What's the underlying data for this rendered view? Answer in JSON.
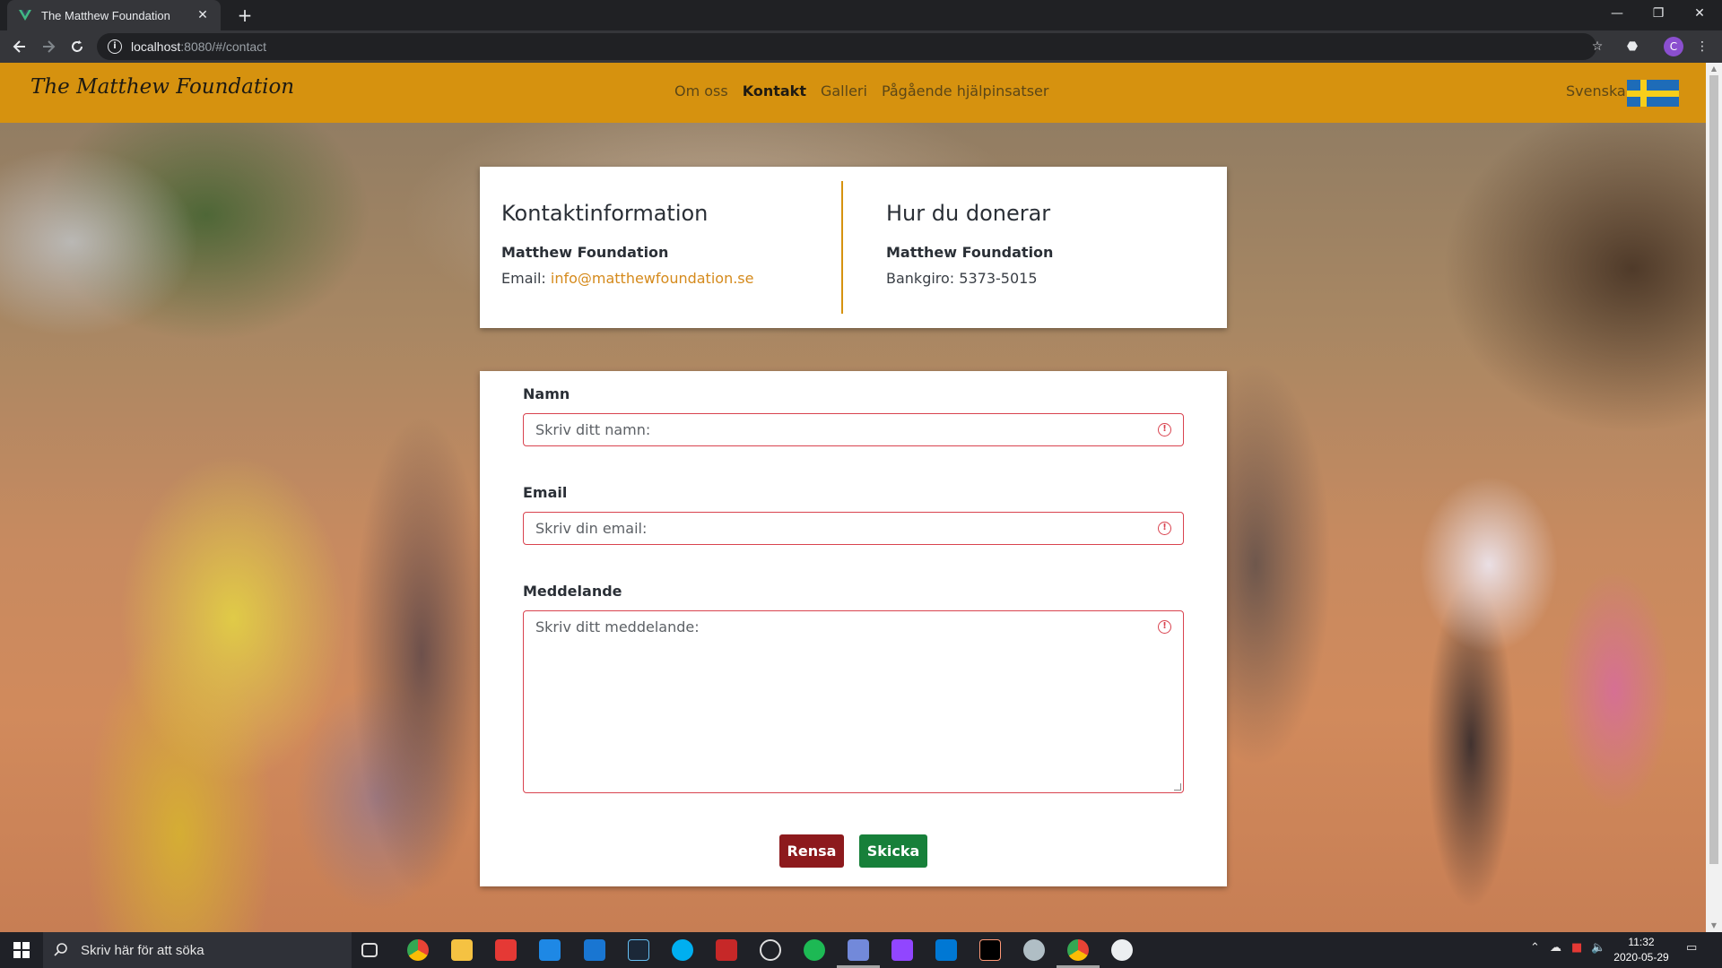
{
  "browser": {
    "tab_title": "The Matthew Foundation",
    "url_host": "localhost",
    "url_rest": ":8080/#/contact",
    "profile_initial": "C"
  },
  "site": {
    "brand": "The Matthew Foundation",
    "nav": [
      "Om oss",
      "Kontakt",
      "Galleri",
      "Pågående hjälpinsatser"
    ],
    "active_nav": "Kontakt",
    "language": "Svenska"
  },
  "contact_info": {
    "heading": "Kontaktinformation",
    "org": "Matthew Foundation",
    "email_label": "Email: ",
    "email": "info@matthewfoundation.se"
  },
  "donate": {
    "heading": "Hur du donerar",
    "org": "Matthew Foundation",
    "bankgiro": "Bankgiro: 5373-5015"
  },
  "form": {
    "name_label": "Namn",
    "name_placeholder": "Skriv ditt namn:",
    "email_label": "Email",
    "email_placeholder": "Skriv din email:",
    "message_label": "Meddelande",
    "message_placeholder": "Skriv ditt meddelande:",
    "clear_button": "Rensa",
    "send_button": "Skicka"
  },
  "taskbar": {
    "search_text": "Skriv här för att söka",
    "time": "11:32",
    "date": "2020-05-29"
  },
  "colors": {
    "accent": "#d6920f",
    "error": "#d9434f",
    "clear": "#8d1a1d",
    "send": "#17803a"
  }
}
